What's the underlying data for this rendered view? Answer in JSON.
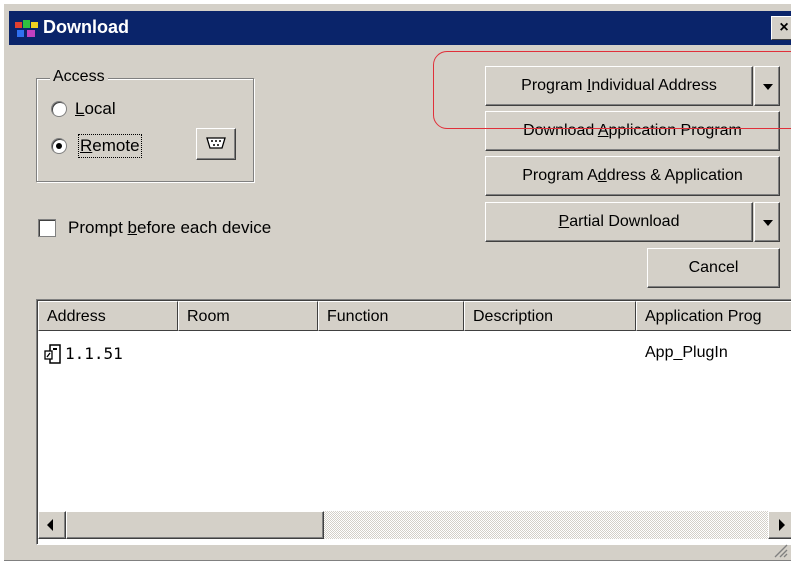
{
  "window": {
    "title": "Download",
    "close_glyph": "×"
  },
  "access": {
    "group_label": "Access",
    "local": {
      "prefix": "",
      "mnemonic": "L",
      "rest": "ocal",
      "selected": false
    },
    "remote": {
      "prefix": "",
      "mnemonic": "R",
      "rest": "emote",
      "selected": true
    },
    "settings_icon": "connector-icon"
  },
  "prompt": {
    "before": "Prompt ",
    "mnemonic": "b",
    "after": "efore each device",
    "checked": false
  },
  "buttons": {
    "program_individual_address": {
      "before": "Program ",
      "mnemonic": "I",
      "after": "ndividual Address"
    },
    "download_application_program": {
      "before": "Download ",
      "mnemonic": "A",
      "after": "pplication Program"
    },
    "program_address_application": {
      "before": "Program A",
      "mnemonic": "d",
      "after": "dress & Application"
    },
    "partial_download": {
      "before": "",
      "mnemonic": "P",
      "after": "artial Download"
    },
    "cancel": "Cancel"
  },
  "list": {
    "columns": [
      "Address",
      "Room",
      "Function",
      "Description",
      "Application Prog"
    ],
    "rows": [
      {
        "address": "1.1.51",
        "room": "",
        "function": "",
        "description": "",
        "application": "App_PlugIn"
      }
    ]
  },
  "colors": {
    "titlebar": "#0a246a",
    "highlight": "#e0303a",
    "face": "#d4d0c8"
  }
}
